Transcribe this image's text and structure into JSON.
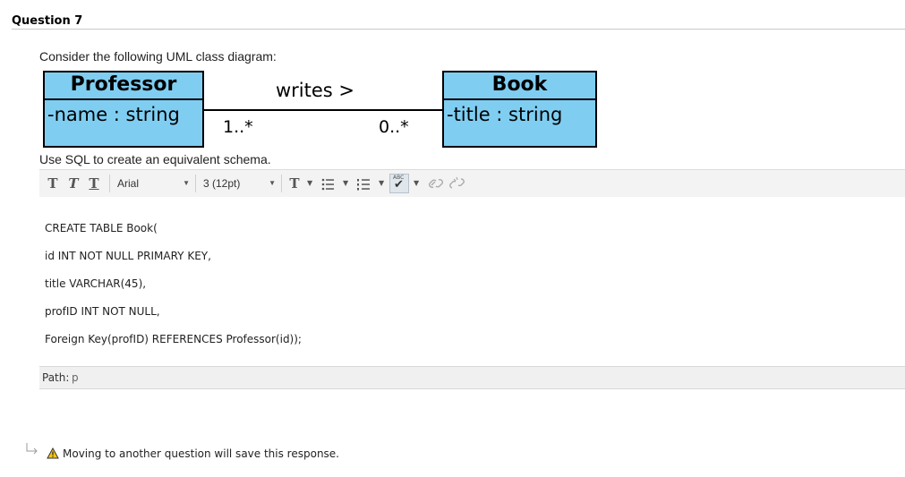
{
  "question": {
    "title": "Question 7"
  },
  "prompt": "Consider the following UML class diagram:",
  "diagram": {
    "left_class": {
      "name": "Professor",
      "attribute": "-name : string"
    },
    "right_class": {
      "name": "Book",
      "attribute": "-title : string"
    },
    "association": {
      "label": "writes >",
      "left_multiplicity": "1..*",
      "right_multiplicity": "0..*"
    }
  },
  "instruction": "Use SQL to create an equivalent schema.",
  "toolbar": {
    "font_family": "Arial",
    "font_size": "3 (12pt)",
    "bold_label": "T",
    "italic_label": "T",
    "underline_label": "T",
    "text_color_label": "T",
    "spellcheck_label": "ABC"
  },
  "editor": {
    "lines": [
      "CREATE TABLE Book(",
      "id INT NOT NULL PRIMARY KEY,",
      "title VARCHAR(45),",
      "profID INT NOT NULL,",
      "Foreign Key(profID) REFERENCES Professor(id));"
    ]
  },
  "path_bar": {
    "label": "Path:",
    "value": "p"
  },
  "notice": {
    "text": "Moving to another question will save this response."
  }
}
